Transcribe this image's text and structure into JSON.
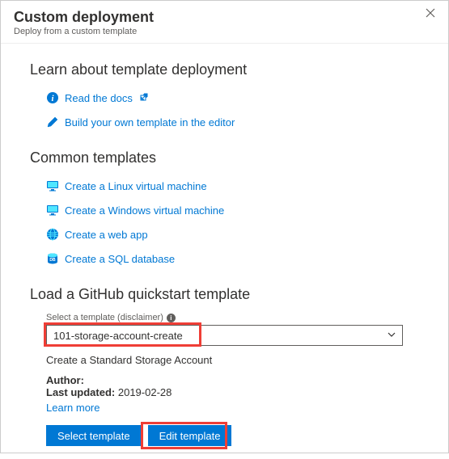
{
  "header": {
    "title": "Custom deployment",
    "subtitle": "Deploy from a custom template"
  },
  "learn": {
    "heading": "Learn about template deployment",
    "docs_link": "Read the docs",
    "build_link": "Build your own template in the editor"
  },
  "common": {
    "heading": "Common templates",
    "linux": "Create a Linux virtual machine",
    "windows": "Create a Windows virtual machine",
    "webapp": "Create a web app",
    "sql": "Create a SQL database"
  },
  "github": {
    "heading": "Load a GitHub quickstart template",
    "select_label": "Select a template (disclaimer)",
    "selected_value": "101-storage-account-create",
    "description": "Create a Standard Storage Account",
    "author_label": "Author:",
    "updated_label": "Last updated:",
    "updated_value": "2019-02-28",
    "learn_more": "Learn more",
    "select_button": "Select template",
    "edit_button": "Edit template"
  }
}
